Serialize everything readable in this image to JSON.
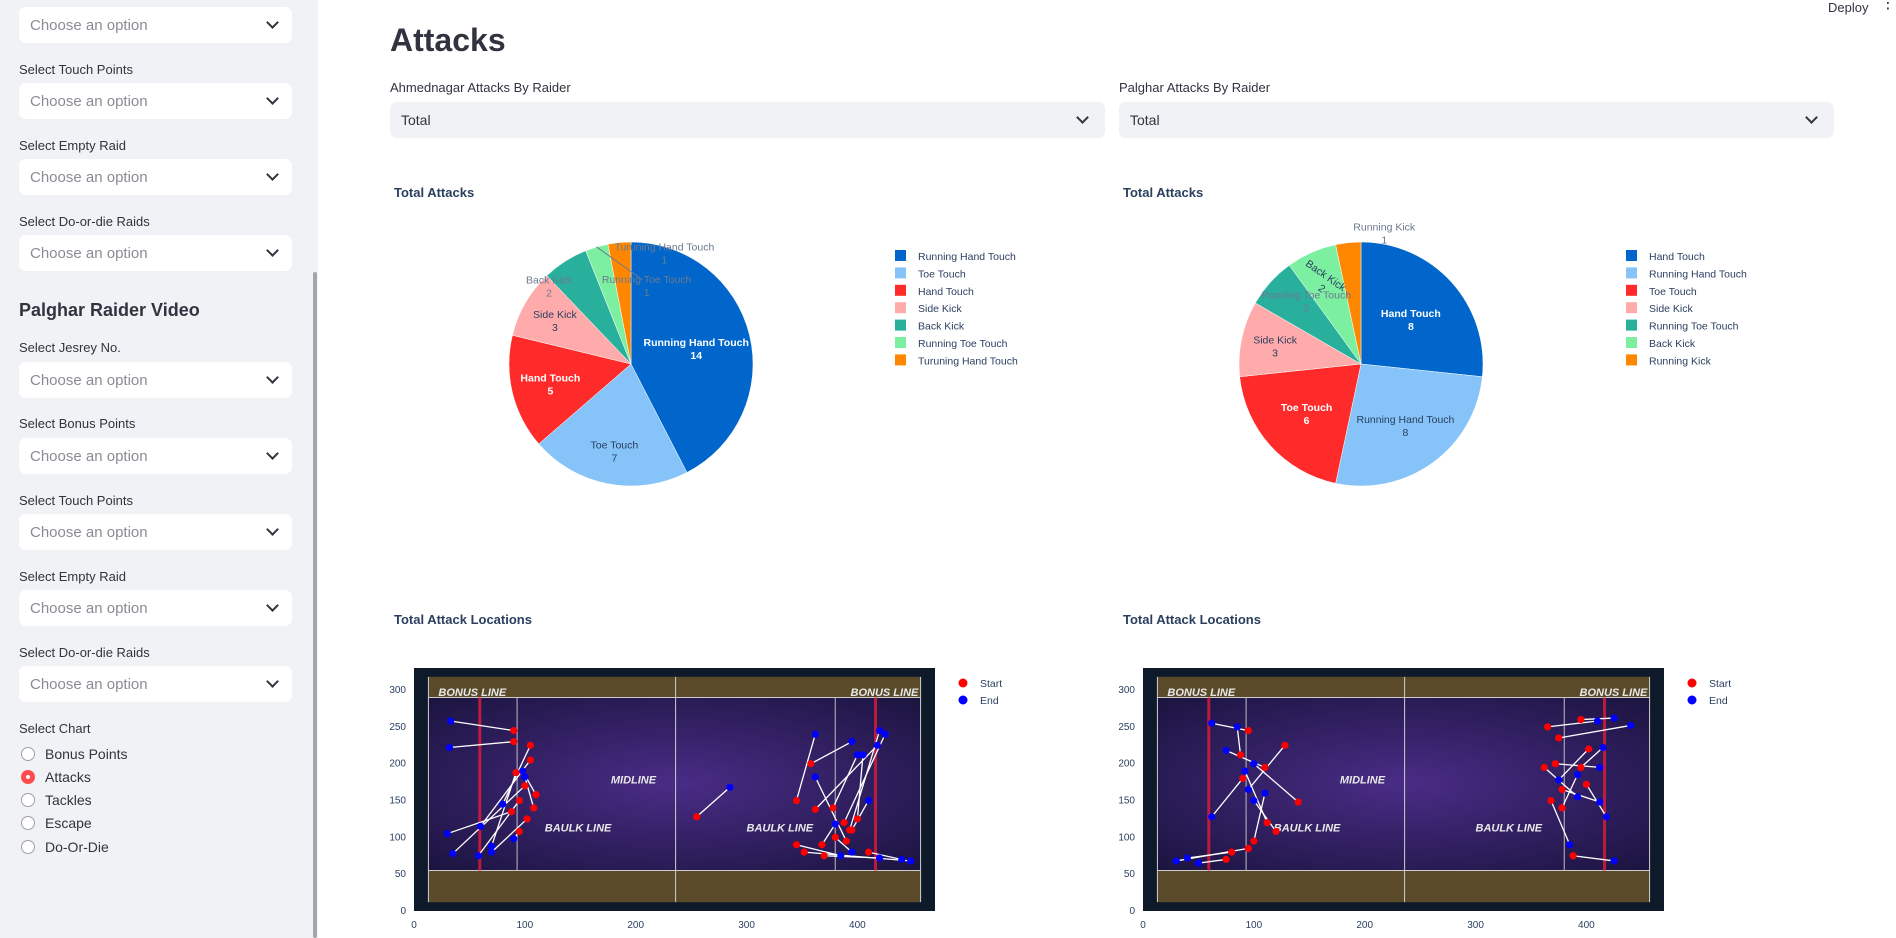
{
  "sidebar": {
    "top_select": {
      "placeholder": "Choose an option"
    },
    "ahmednagar_filters": [
      {
        "label": "Select Touch Points",
        "placeholder": "Choose an option"
      },
      {
        "label": "Select Empty Raid",
        "placeholder": "Choose an option"
      },
      {
        "label": "Select Do-or-die Raids",
        "placeholder": "Choose an option"
      }
    ],
    "palghar_heading": "Palghar Raider Video",
    "palghar_filters": [
      {
        "label": "Select Jesrey No.",
        "placeholder": "Choose an option"
      },
      {
        "label": "Select Bonus Points",
        "placeholder": "Choose an option"
      },
      {
        "label": "Select Touch Points",
        "placeholder": "Choose an option"
      },
      {
        "label": "Select Empty Raid",
        "placeholder": "Choose an option"
      },
      {
        "label": "Select Do-or-die Raids",
        "placeholder": "Choose an option"
      }
    ],
    "chart_select_label": "Select Chart",
    "chart_options": [
      {
        "label": "Bonus Points",
        "selected": false
      },
      {
        "label": "Attacks",
        "selected": true
      },
      {
        "label": "Tackles",
        "selected": false
      },
      {
        "label": "Escape",
        "selected": false
      },
      {
        "label": "Do-Or-Die",
        "selected": false
      }
    ]
  },
  "header": {
    "deploy_label": "Deploy",
    "menu_icon": "vertical-dots-icon"
  },
  "main": {
    "title": "Attacks",
    "left_select": {
      "label": "Ahmednagar Attacks By Raider",
      "value": "Total"
    },
    "right_select": {
      "label": "Palghar Attacks By Raider",
      "value": "Total"
    },
    "pie_titles": [
      "Total Attacks",
      "Total Attacks"
    ],
    "scatter_titles": [
      "Total Attack Locations",
      "Total Attack Locations"
    ],
    "court_text": {
      "bonus": "BONUS LINE",
      "mid": "MIDLINE",
      "baulk": "BAULK LINE"
    }
  },
  "colors": {
    "accent": "#ff4b4b",
    "start": "#ff0000",
    "end": "#0000ff"
  },
  "chart_data": [
    {
      "type": "pie",
      "title": "Total Attacks",
      "labels": [
        "Running Hand Touch",
        "Toe Touch",
        "Hand Touch",
        "Side Kick",
        "Back Kick",
        "Running Toe Touch",
        "Turuning Hand Touch"
      ],
      "values": [
        14,
        7,
        5,
        3,
        2,
        1,
        1
      ],
      "colors": [
        "#0066cc",
        "#85c3f8",
        "#ff2b2b",
        "#ffabab",
        "#29b09d",
        "#7defa1",
        "#ff8700"
      ],
      "legend": "right"
    },
    {
      "type": "pie",
      "title": "Total Attacks",
      "labels": [
        "Hand Touch",
        "Running Hand Touch",
        "Toe Touch",
        "Side Kick",
        "Running Toe Touch",
        "Back Kick",
        "Running Kick"
      ],
      "values": [
        8,
        8,
        6,
        3,
        2,
        2,
        1
      ],
      "colors": [
        "#0066cc",
        "#85c3f8",
        "#ff2b2b",
        "#ffabab",
        "#29b09d",
        "#7defa1",
        "#ff8700"
      ],
      "legend": "right"
    },
    {
      "type": "scatter",
      "title": "Total Attack Locations",
      "xlim": [
        0,
        470
      ],
      "ylim": [
        0,
        330
      ],
      "xticks": [
        0,
        100,
        200,
        300,
        400
      ],
      "yticks": [
        0,
        50,
        100,
        150,
        200,
        250,
        300
      ],
      "legend": [
        "Start",
        "End"
      ],
      "pairs": [
        [
          [
            90,
            245
          ],
          [
            33,
            258
          ]
        ],
        [
          [
            90,
            230
          ],
          [
            32,
            222
          ]
        ],
        [
          [
            105,
            225
          ],
          [
            80,
            145
          ]
        ],
        [
          [
            105,
            205
          ],
          [
            60,
            115
          ]
        ],
        [
          [
            100,
            170
          ],
          [
            35,
            78
          ]
        ],
        [
          [
            95,
            150
          ],
          [
            58,
            75
          ]
        ],
        [
          [
            88,
            135
          ],
          [
            30,
            105
          ]
        ],
        [
          [
            102,
            125
          ],
          [
            70,
            80
          ]
        ],
        [
          [
            110,
            158
          ],
          [
            98,
            190
          ]
        ],
        [
          [
            95,
            108
          ],
          [
            90,
            98
          ]
        ],
        [
          [
            92,
            188
          ],
          [
            70,
            88
          ]
        ],
        [
          [
            108,
            140
          ],
          [
            100,
            182
          ]
        ],
        [
          [
            255,
            128
          ],
          [
            285,
            168
          ]
        ],
        [
          [
            345,
            150
          ],
          [
            362,
            240
          ]
        ],
        [
          [
            378,
            140
          ],
          [
            400,
            212
          ]
        ],
        [
          [
            362,
            138
          ],
          [
            418,
            225
          ]
        ],
        [
          [
            388,
            120
          ],
          [
            425,
            240
          ]
        ],
        [
          [
            393,
            110
          ],
          [
            420,
            245
          ]
        ],
        [
          [
            400,
            125
          ],
          [
            405,
            212
          ]
        ],
        [
          [
            390,
            95
          ],
          [
            362,
            182
          ]
        ],
        [
          [
            368,
            90
          ],
          [
            380,
            118
          ]
        ],
        [
          [
            345,
            90
          ],
          [
            385,
            75
          ]
        ],
        [
          [
            352,
            80
          ],
          [
            448,
            68
          ]
        ],
        [
          [
            370,
            75
          ],
          [
            420,
            72
          ]
        ],
        [
          [
            410,
            80
          ],
          [
            440,
            70
          ]
        ],
        [
          [
            380,
            100
          ],
          [
            395,
            80
          ]
        ],
        [
          [
            358,
            200
          ],
          [
            395,
            230
          ]
        ],
        [
          [
            395,
            110
          ],
          [
            410,
            150
          ]
        ]
      ]
    },
    {
      "type": "scatter",
      "title": "Total Attack Locations",
      "xlim": [
        0,
        470
      ],
      "ylim": [
        0,
        330
      ],
      "xticks": [
        0,
        100,
        200,
        300,
        400
      ],
      "yticks": [
        0,
        50,
        100,
        150,
        200,
        250,
        300
      ],
      "legend": [
        "Start",
        "End"
      ],
      "pairs": [
        [
          [
            95,
            245
          ],
          [
            62,
            255
          ]
        ],
        [
          [
            88,
            212
          ],
          [
            85,
            250
          ]
        ],
        [
          [
            110,
            195
          ],
          [
            75,
            218
          ]
        ],
        [
          [
            128,
            225
          ],
          [
            95,
            165
          ]
        ],
        [
          [
            140,
            148
          ],
          [
            100,
            200
          ]
        ],
        [
          [
            90,
            180
          ],
          [
            62,
            128
          ]
        ],
        [
          [
            112,
            120
          ],
          [
            92,
            190
          ]
        ],
        [
          [
            120,
            108
          ],
          [
            100,
            150
          ]
        ],
        [
          [
            95,
            85
          ],
          [
            30,
            68
          ]
        ],
        [
          [
            80,
            80
          ],
          [
            40,
            72
          ]
        ],
        [
          [
            75,
            70
          ],
          [
            50,
            65
          ]
        ],
        [
          [
            100,
            95
          ],
          [
            110,
            160
          ]
        ],
        [
          [
            365,
            250
          ],
          [
            410,
            258
          ]
        ],
        [
          [
            375,
            235
          ],
          [
            440,
            252
          ]
        ],
        [
          [
            395,
            260
          ],
          [
            425,
            262
          ]
        ],
        [
          [
            372,
            200
          ],
          [
            412,
            195
          ]
        ],
        [
          [
            362,
            195
          ],
          [
            392,
            155
          ]
        ],
        [
          [
            378,
            165
          ],
          [
            412,
            148
          ]
        ],
        [
          [
            368,
            150
          ],
          [
            385,
            90
          ]
        ],
        [
          [
            400,
            172
          ],
          [
            418,
            128
          ]
        ],
        [
          [
            395,
            195
          ],
          [
            415,
            222
          ]
        ],
        [
          [
            388,
            75
          ],
          [
            425,
            68
          ]
        ],
        [
          [
            378,
            140
          ],
          [
            392,
            185
          ]
        ],
        [
          [
            402,
            220
          ],
          [
            375,
            178
          ]
        ]
      ]
    }
  ]
}
